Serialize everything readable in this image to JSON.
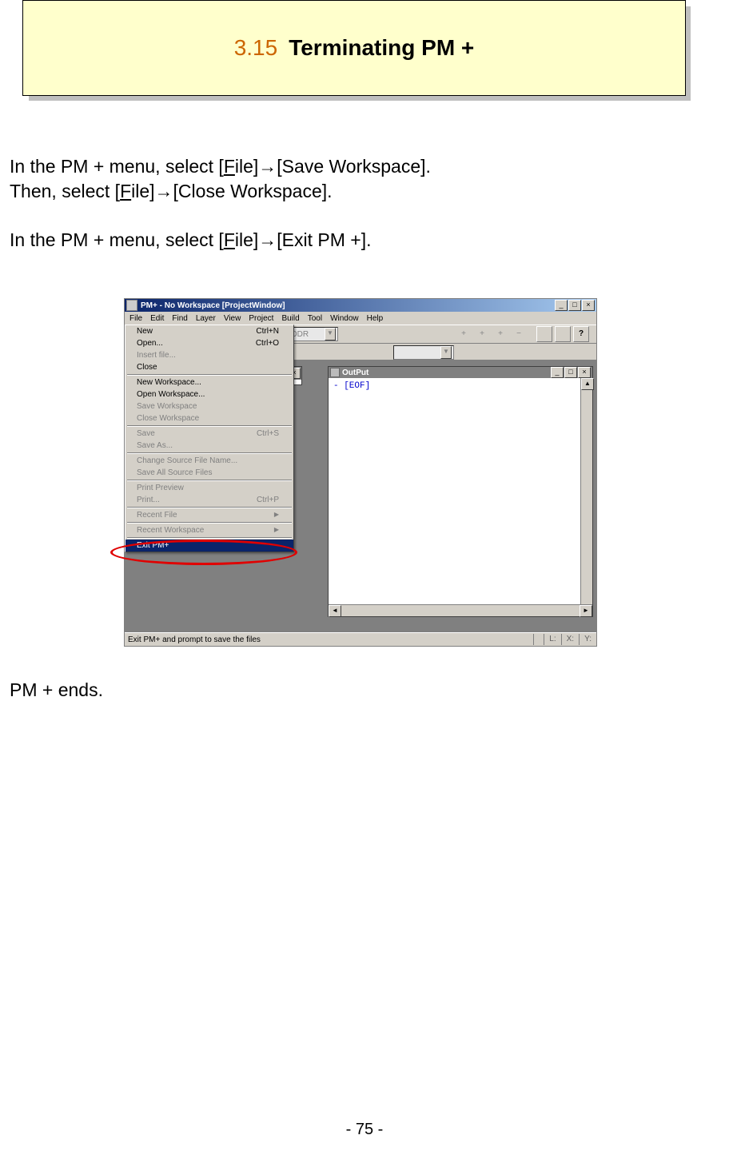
{
  "heading": {
    "number": "3.15",
    "title": "Terminating PM +"
  },
  "para1a": "In the PM + menu, select [",
  "para1b": "ile]→[Save Workspace].",
  "para2a": "Then, select [",
  "para2b": "ile]→[Close Workspace].",
  "para3a": "In the PM + menu, select [",
  "para3b": "ile]→[Exit PM +].",
  "fileMnemonic": "F",
  "afterShot": "PM + ends.",
  "pageNumber": "- 75 -",
  "screenshot": {
    "title": "PM+ - No Workspace  [ProjectWindow]",
    "menubar": [
      "File",
      "Edit",
      "Find",
      "Layer",
      "View",
      "Project",
      "Build",
      "Tool",
      "Window",
      "Help"
    ],
    "comboText": "MAC_ADDR",
    "outputTitle": "OutPut",
    "outputContent": "- [EOF]",
    "status": "Exit PM+ and prompt to save the files",
    "statusR1": "L:",
    "statusR2": "X:",
    "statusR3": "Y:",
    "fileMenu": [
      {
        "label": "New",
        "accel": "Ctrl+N",
        "disabled": false
      },
      {
        "label": "Open...",
        "accel": "Ctrl+O",
        "disabled": false
      },
      {
        "label": "Insert file...",
        "accel": "",
        "disabled": true
      },
      {
        "label": "Close",
        "accel": "",
        "disabled": false
      },
      {
        "sep": true
      },
      {
        "label": "New Workspace...",
        "accel": "",
        "disabled": false
      },
      {
        "label": "Open Workspace...",
        "accel": "",
        "disabled": false
      },
      {
        "label": "Save Workspace",
        "accel": "",
        "disabled": true
      },
      {
        "label": "Close Workspace",
        "accel": "",
        "disabled": true
      },
      {
        "sep": true
      },
      {
        "label": "Save",
        "accel": "Ctrl+S",
        "disabled": true
      },
      {
        "label": "Save As...",
        "accel": "",
        "disabled": true
      },
      {
        "sep": true
      },
      {
        "label": "Change Source File Name...",
        "accel": "",
        "disabled": true
      },
      {
        "label": "Save All Source Files",
        "accel": "",
        "disabled": true
      },
      {
        "sep": true
      },
      {
        "label": "Print Preview",
        "accel": "",
        "disabled": true
      },
      {
        "label": "Print...",
        "accel": "Ctrl+P",
        "disabled": true
      },
      {
        "sep": true
      },
      {
        "label": "Recent File",
        "accel": "",
        "disabled": true,
        "arrow": true
      },
      {
        "sep": true
      },
      {
        "label": "Recent Workspace",
        "accel": "",
        "disabled": true,
        "arrow": true
      },
      {
        "sep": true
      },
      {
        "label": "Exit PM+",
        "accel": "",
        "disabled": false,
        "selected": true
      }
    ]
  }
}
